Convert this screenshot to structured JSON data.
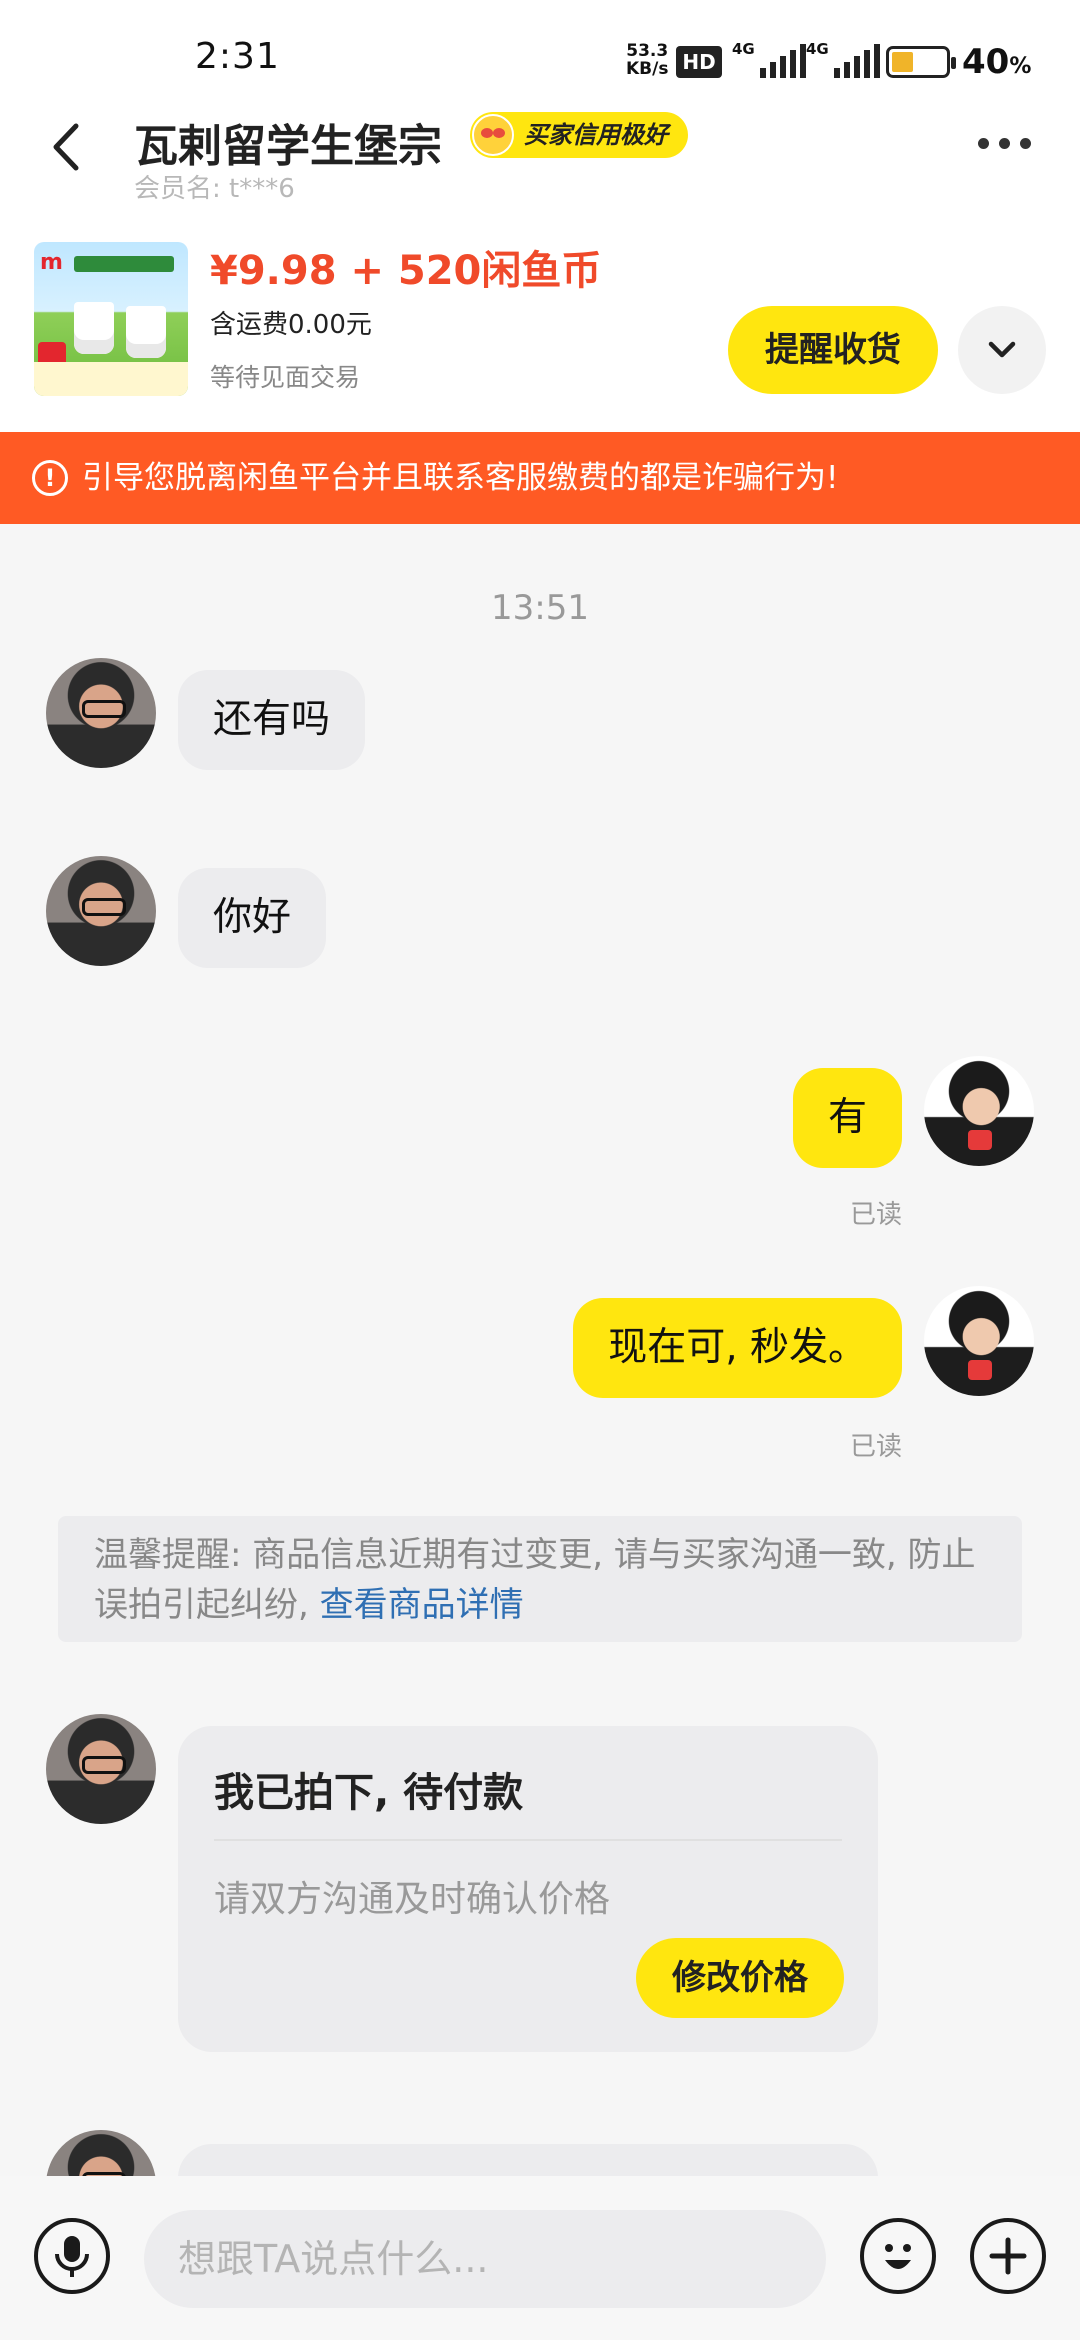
{
  "status_bar": {
    "time": "2:31",
    "speed_value": "53.3",
    "speed_unit": "KB/s",
    "hd_label": "HD",
    "network_1": "4G",
    "network_2": "4G",
    "battery_percent": "40",
    "battery_unit": "%",
    "battery_level": 0.4
  },
  "header": {
    "shop_name": "瓦剌留学生堡宗",
    "credit_badge": "买家信用极好",
    "member_label": "会员名: t***6"
  },
  "product": {
    "price": "¥9.98 + 520闲鱼币",
    "shipping": "含运费0.00元",
    "status": "等待见面交易",
    "remind_button": "提醒收货",
    "thumb_logo": "m"
  },
  "warning": {
    "icon": "!",
    "text": "引导您脱离闲鱼平台并且联系客服缴费的都是诈骗行为!"
  },
  "chat": {
    "timestamp": "13:51",
    "messages": [
      {
        "text": "还有吗"
      },
      {
        "text": "你好"
      },
      {
        "text": "有",
        "read": "已读"
      },
      {
        "text": "现在可, 秒发。",
        "read": "已读"
      }
    ],
    "notice": {
      "text": "温馨提醒: 商品信息近期有过变更, 请与买家沟通一致, 防止误拍引起纠纷, ",
      "link": "查看商品详情"
    },
    "order_card": {
      "title": "我已拍下, 待付款",
      "subtitle": "请双方沟通及时确认价格",
      "button": "修改价格"
    }
  },
  "input_bar": {
    "placeholder": "想跟TA说点什么..."
  },
  "colors": {
    "accent_yellow": "#ffe60f",
    "warning_orange": "#ff5a24",
    "price_red": "#f04a2a",
    "link_blue": "#2f6fb3"
  }
}
